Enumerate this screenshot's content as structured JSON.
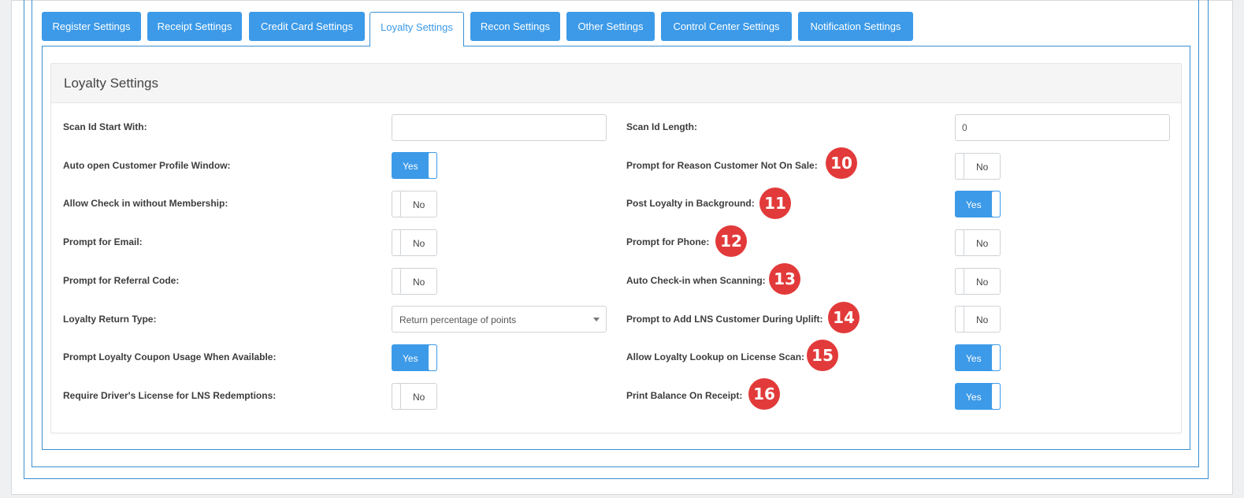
{
  "tabs": [
    {
      "label": "Register Settings"
    },
    {
      "label": "Receipt Settings"
    },
    {
      "label": "Credit Card Settings"
    },
    {
      "label": "Loyalty Settings"
    },
    {
      "label": "Recon Settings"
    },
    {
      "label": "Other Settings"
    },
    {
      "label": "Control Center Settings"
    },
    {
      "label": "Notification Settings"
    }
  ],
  "active_tab": "Loyalty Settings",
  "panel": {
    "title": "Loyalty Settings"
  },
  "left": [
    {
      "label": "Scan Id Start With:",
      "type": "text",
      "value": ""
    },
    {
      "label": "Auto open Customer Profile Window:",
      "type": "toggle",
      "state": "Yes"
    },
    {
      "label": "Allow Check in without Membership:",
      "type": "toggle",
      "state": "No"
    },
    {
      "label": "Prompt for Email:",
      "type": "toggle",
      "state": "No"
    },
    {
      "label": "Prompt for Referral Code:",
      "type": "toggle",
      "state": "No"
    },
    {
      "label": "Loyalty Return Type:",
      "type": "select",
      "value": "Return percentage of points"
    },
    {
      "label": "Prompt Loyalty Coupon Usage When Available:",
      "type": "toggle",
      "state": "Yes"
    },
    {
      "label": "Require Driver's License for LNS Redemptions:",
      "type": "toggle",
      "state": "No"
    }
  ],
  "right": [
    {
      "label": "Scan Id Length:",
      "type": "text",
      "value": "0"
    },
    {
      "label": "Prompt for Reason Customer Not On Sale:",
      "type": "toggle",
      "state": "No",
      "badge": "10"
    },
    {
      "label": "Post Loyalty in Background:",
      "type": "toggle",
      "state": "Yes",
      "badge": "11"
    },
    {
      "label": "Prompt for Phone:",
      "type": "toggle",
      "state": "No",
      "badge": "12"
    },
    {
      "label": "Auto Check-in when Scanning:",
      "type": "toggle",
      "state": "No",
      "badge": "13"
    },
    {
      "label": "Prompt to Add LNS Customer During Uplift:",
      "type": "toggle",
      "state": "No",
      "badge": "14"
    },
    {
      "label": "Allow Loyalty Lookup on License Scan:",
      "type": "toggle",
      "state": "Yes",
      "badge": "15"
    },
    {
      "label": "Print Balance On Receipt:",
      "type": "toggle",
      "state": "Yes",
      "badge": "16"
    }
  ],
  "colors": {
    "accent": "#3c9ae8",
    "badge": "#e23a3a",
    "border": "#3a8fd0"
  }
}
